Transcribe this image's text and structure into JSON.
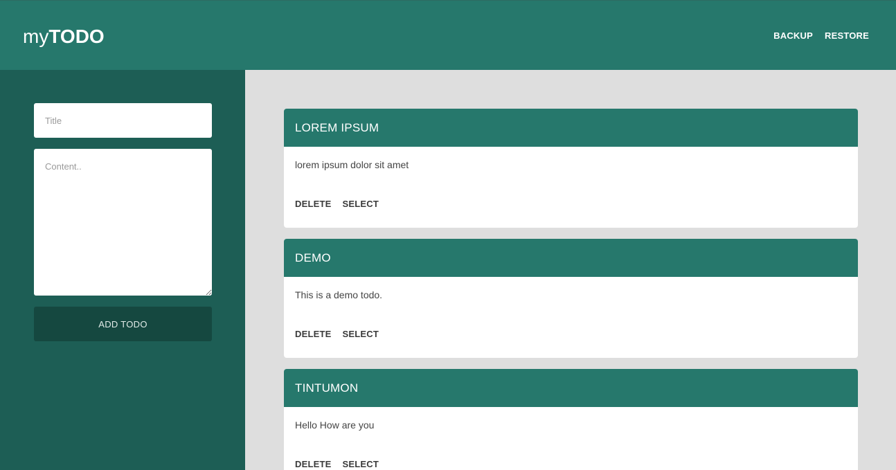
{
  "header": {
    "brand_prefix": "my",
    "brand_bold": "TODO",
    "nav": [
      "BACKUP",
      "RESTORE"
    ]
  },
  "sidebar": {
    "title_placeholder": "Title",
    "content_placeholder": "Content..",
    "add_button_label": "ADD TODO"
  },
  "todos": [
    {
      "title": "LOREM IPSUM",
      "content": "lorem ipsum dolor sit amet",
      "delete_label": "DELETE",
      "select_label": "SELECT"
    },
    {
      "title": "DEMO",
      "content": "This is a demo todo.",
      "delete_label": "DELETE",
      "select_label": "SELECT"
    },
    {
      "title": "TINTUMON",
      "content": "Hello How are you",
      "delete_label": "DELETE",
      "select_label": "SELECT"
    }
  ],
  "colors": {
    "primary": "#26786c",
    "sidebar": "#1d5e55",
    "button_dark": "#154840",
    "background": "#dedede"
  }
}
